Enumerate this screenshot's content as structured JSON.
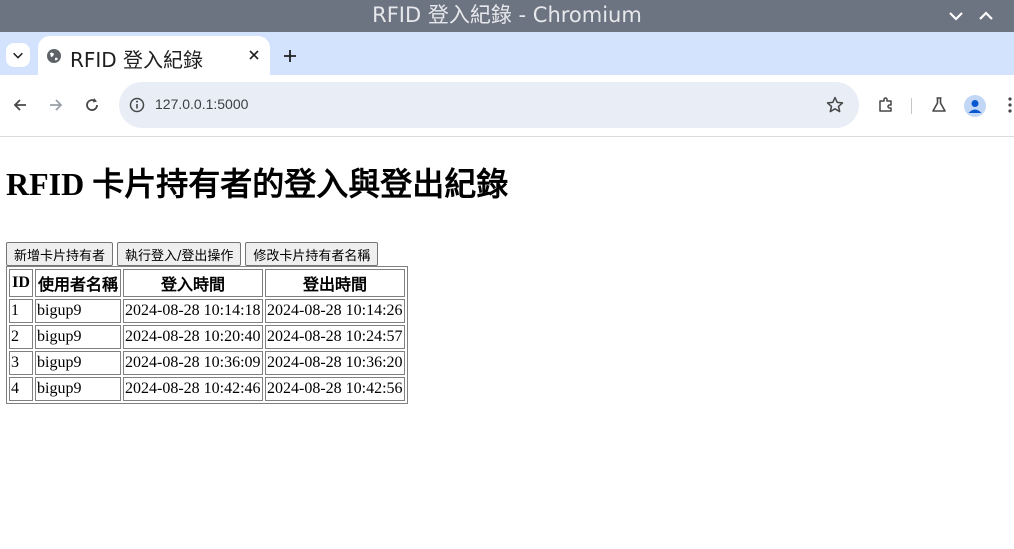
{
  "window": {
    "title": "RFID 登入紀錄 - Chromium"
  },
  "tab": {
    "title": "RFID 登入紀錄"
  },
  "omnibox": {
    "url": "127.0.0.1:5000"
  },
  "page": {
    "heading": "RFID 卡片持有者的登入與登出紀錄",
    "buttons": {
      "add": "新增卡片持有者",
      "login_logout": "執行登入/登出操作",
      "rename": "修改卡片持有者名稱"
    },
    "table": {
      "headers": [
        "ID",
        "使用者名稱",
        "登入時間",
        "登出時間"
      ],
      "rows": [
        [
          "1",
          "bigup9",
          "2024-08-28 10:14:18",
          "2024-08-28 10:14:26"
        ],
        [
          "2",
          "bigup9",
          "2024-08-28 10:20:40",
          "2024-08-28 10:24:57"
        ],
        [
          "3",
          "bigup9",
          "2024-08-28 10:36:09",
          "2024-08-28 10:36:20"
        ],
        [
          "4",
          "bigup9",
          "2024-08-28 10:42:46",
          "2024-08-28 10:42:56"
        ]
      ]
    }
  },
  "icons": {
    "tab_search": "chevron-down-icon",
    "favicon": "globe-icon",
    "tab_close": "close-icon",
    "new_tab": "plus-icon",
    "back": "arrow-left-icon",
    "forward": "arrow-right-icon",
    "reload": "reload-icon",
    "site_info": "info-icon",
    "bookmark": "star-icon",
    "extensions": "puzzle-icon",
    "labs": "flask-icon",
    "profile": "avatar-icon",
    "menu": "kebab-menu-icon"
  },
  "colors": {
    "titlebar": "#6d7481",
    "tabstrip": "#d3e3fd",
    "omnibox": "#e9eef6"
  }
}
